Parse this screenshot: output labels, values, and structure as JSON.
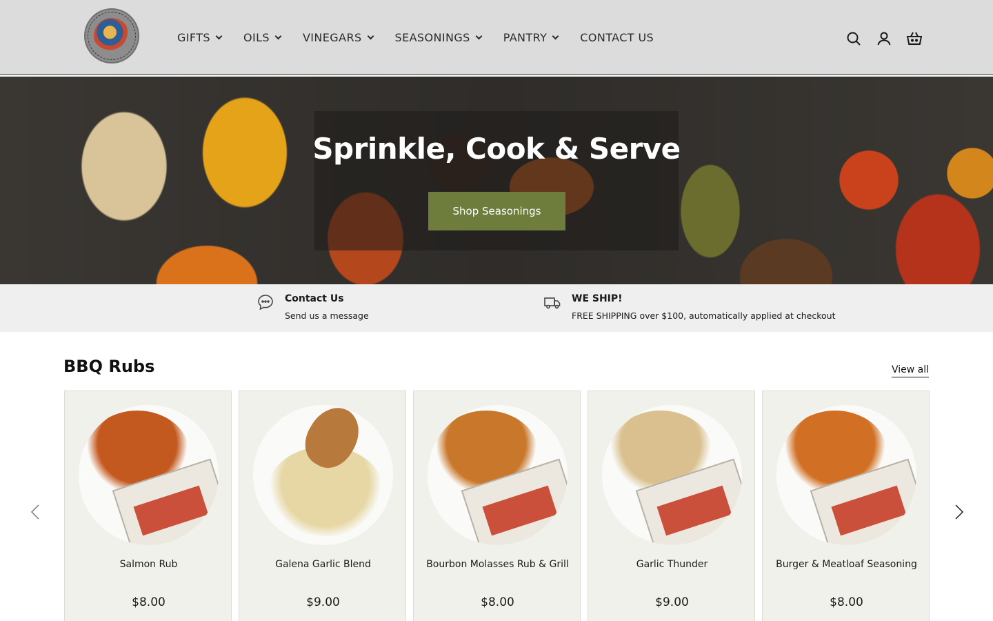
{
  "header": {
    "logo_text": "GALENA GARLIC COMPANY",
    "nav": [
      {
        "label": "GIFTS",
        "dropdown": true
      },
      {
        "label": "OILS",
        "dropdown": true
      },
      {
        "label": "VINEGARS",
        "dropdown": true
      },
      {
        "label": "SEASONINGS",
        "dropdown": true
      },
      {
        "label": "PANTRY",
        "dropdown": true
      },
      {
        "label": "CONTACT US",
        "dropdown": false
      }
    ],
    "icons": [
      "search-icon",
      "account-icon",
      "cart-icon"
    ]
  },
  "hero": {
    "title": "Sprinkle, Cook & Serve",
    "button_label": "Shop Seasonings"
  },
  "infobar": {
    "items": [
      {
        "icon": "chat-icon",
        "title": "Contact Us",
        "subtitle": "Send us a message"
      },
      {
        "icon": "truck-icon",
        "title": "WE SHIP!",
        "subtitle": "FREE SHIPPING over $100, automatically applied at checkout"
      }
    ]
  },
  "section": {
    "title": "BBQ Rubs",
    "view_all": "View all",
    "products": [
      {
        "name": "Salmon Rub",
        "price": "$8.00",
        "color": "#c4591f"
      },
      {
        "name": "Galena Garlic Blend",
        "price": "$9.00",
        "color": "#e6d7a4"
      },
      {
        "name": "Bourbon Molasses Rub & Grill",
        "price": "$8.00",
        "color": "#c9772a"
      },
      {
        "name": "Garlic Thunder",
        "price": "$9.00",
        "color": "#d9c08e"
      },
      {
        "name": "Burger & Meatloaf Seasoning",
        "price": "$8.00",
        "color": "#d17024"
      }
    ]
  },
  "colors": {
    "header_bg": "#dcdcdc",
    "button_bg": "#6e7d3b",
    "infobar_bg": "#efefef",
    "card_bg": "#f1f1ec"
  }
}
